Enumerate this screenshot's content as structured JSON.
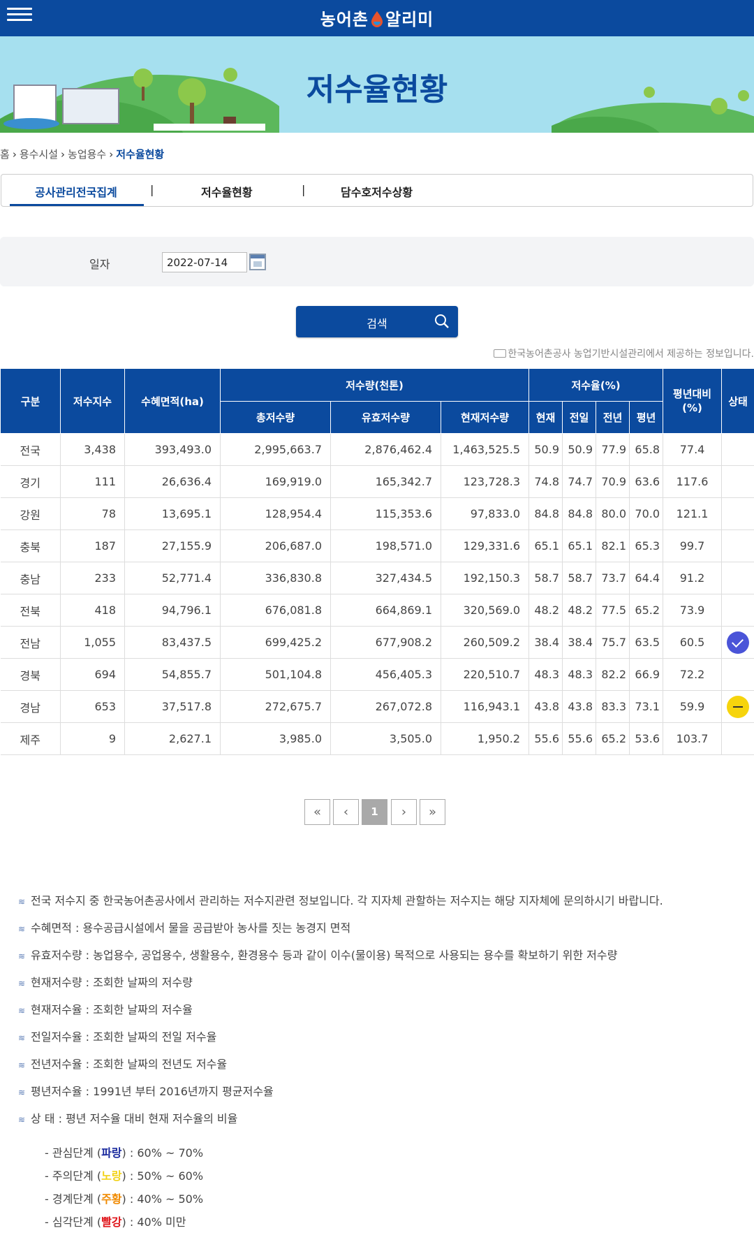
{
  "header": {
    "logo_text_1": "농어촌",
    "logo_text_2": "알리미"
  },
  "banner": {
    "title": "저수율현황"
  },
  "breadcrumb": {
    "items": [
      "홈",
      "용수시설",
      "농업용수",
      "저수율현황"
    ]
  },
  "tabs": [
    {
      "label": "공사관리전국집계",
      "active": true
    },
    {
      "label": "저수율현황",
      "active": false
    },
    {
      "label": "담수호저수상황",
      "active": false
    }
  ],
  "search": {
    "date_label": "일자",
    "date_value": "2022-07-14",
    "button_label": "검색"
  },
  "source_note": "한국농어촌공사 농업기반시설관리에서 제공하는 정보입니다.",
  "table": {
    "headers": {
      "region": "구분",
      "count": "저수지수",
      "area": "수혜면적(ha)",
      "volume_group": "저수량(천톤)",
      "total": "총저수량",
      "effective": "유효저수량",
      "current": "현재저수량",
      "rate_group": "저수율(%)",
      "now": "현재",
      "prev_day": "전일",
      "prev_year": "전년",
      "avg": "평년",
      "vs_avg": "평년대비(%)",
      "status": "상태"
    },
    "rows": [
      {
        "region": "전국",
        "count": "3,438",
        "area": "393,493.0",
        "total": "2,995,663.7",
        "effective": "2,876,462.4",
        "current": "1,463,525.5",
        "now": "50.9",
        "prev_day": "50.9",
        "prev_year": "77.9",
        "avg": "65.8",
        "vs_avg": "77.4",
        "status": ""
      },
      {
        "region": "경기",
        "count": "111",
        "area": "26,636.4",
        "total": "169,919.0",
        "effective": "165,342.7",
        "current": "123,728.3",
        "now": "74.8",
        "prev_day": "74.7",
        "prev_year": "70.9",
        "avg": "63.6",
        "vs_avg": "117.6",
        "status": ""
      },
      {
        "region": "강원",
        "count": "78",
        "area": "13,695.1",
        "total": "128,954.4",
        "effective": "115,353.6",
        "current": "97,833.0",
        "now": "84.8",
        "prev_day": "84.8",
        "prev_year": "80.0",
        "avg": "70.0",
        "vs_avg": "121.1",
        "status": ""
      },
      {
        "region": "충북",
        "count": "187",
        "area": "27,155.9",
        "total": "206,687.0",
        "effective": "198,571.0",
        "current": "129,331.6",
        "now": "65.1",
        "prev_day": "65.1",
        "prev_year": "82.1",
        "avg": "65.3",
        "vs_avg": "99.7",
        "status": ""
      },
      {
        "region": "충남",
        "count": "233",
        "area": "52,771.4",
        "total": "336,830.8",
        "effective": "327,434.5",
        "current": "192,150.3",
        "now": "58.7",
        "prev_day": "58.7",
        "prev_year": "73.7",
        "avg": "64.4",
        "vs_avg": "91.2",
        "status": ""
      },
      {
        "region": "전북",
        "count": "418",
        "area": "94,796.1",
        "total": "676,081.8",
        "effective": "664,869.1",
        "current": "320,569.0",
        "now": "48.2",
        "prev_day": "48.2",
        "prev_year": "77.5",
        "avg": "65.2",
        "vs_avg": "73.9",
        "status": ""
      },
      {
        "region": "전남",
        "count": "1,055",
        "area": "83,437.5",
        "total": "699,425.2",
        "effective": "677,908.2",
        "current": "260,509.2",
        "now": "38.4",
        "prev_day": "38.4",
        "prev_year": "75.7",
        "avg": "63.5",
        "vs_avg": "60.5",
        "status": "blue"
      },
      {
        "region": "경북",
        "count": "694",
        "area": "54,855.7",
        "total": "501,104.8",
        "effective": "456,405.3",
        "current": "220,510.7",
        "now": "48.3",
        "prev_day": "48.3",
        "prev_year": "82.2",
        "avg": "66.9",
        "vs_avg": "72.2",
        "status": ""
      },
      {
        "region": "경남",
        "count": "653",
        "area": "37,517.8",
        "total": "272,675.7",
        "effective": "267,072.8",
        "current": "116,943.1",
        "now": "43.8",
        "prev_day": "43.8",
        "prev_year": "83.3",
        "avg": "73.1",
        "vs_avg": "59.9",
        "status": "yellow"
      },
      {
        "region": "제주",
        "count": "9",
        "area": "2,627.1",
        "total": "3,985.0",
        "effective": "3,505.0",
        "current": "1,950.2",
        "now": "55.6",
        "prev_day": "55.6",
        "prev_year": "65.2",
        "avg": "53.6",
        "vs_avg": "103.7",
        "status": ""
      }
    ]
  },
  "pagination": {
    "first": "«",
    "prev": "‹",
    "current": "1",
    "next": "›",
    "last": "»"
  },
  "notes": [
    "전국 저수지 중 한국농어촌공사에서 관리하는 저수지관련 정보입니다. 각 지자체 관할하는 저수지는 해당 지자체에 문의하시기 바랍니다.",
    "수혜면적 : 용수공급시설에서 물을 공급받아 농사를 짓는 농경지 면적",
    "유효저수량 : 농업용수, 공업용수, 생활용수, 환경용수 등과 같이 이수(물이용) 목적으로 사용되는 용수를 확보하기 위한 저수량",
    "현재저수량 : 조회한 날짜의 저수량",
    "현재저수율 : 조회한 날짜의 저수율",
    "전일저수율 : 조회한 날짜의 전일 저수율",
    "전년저수율 : 조회한 날짜의 전년도 저수율",
    "평년저수율 : 1991년 부터 2016년까지 평균저수율",
    "상 태 : 평년 저수율 대비 현재 저수율의 비율"
  ],
  "levels": [
    {
      "prefix": "- 관심단계 (",
      "color_word": "파랑",
      "suffix": ") : 60% ~ 70%",
      "color": "#1a2a9e"
    },
    {
      "prefix": "- 주의단계 (",
      "color_word": "노랑",
      "suffix": ") : 50% ~ 60%",
      "color": "#f2d21a"
    },
    {
      "prefix": "- 경계단계 (",
      "color_word": "주황",
      "suffix": ") : 40% ~ 50%",
      "color": "#f08a00"
    },
    {
      "prefix": "- 심각단계 (",
      "color_word": "빨강",
      "suffix": ") : 40% 미만",
      "color": "#e0161b"
    }
  ]
}
